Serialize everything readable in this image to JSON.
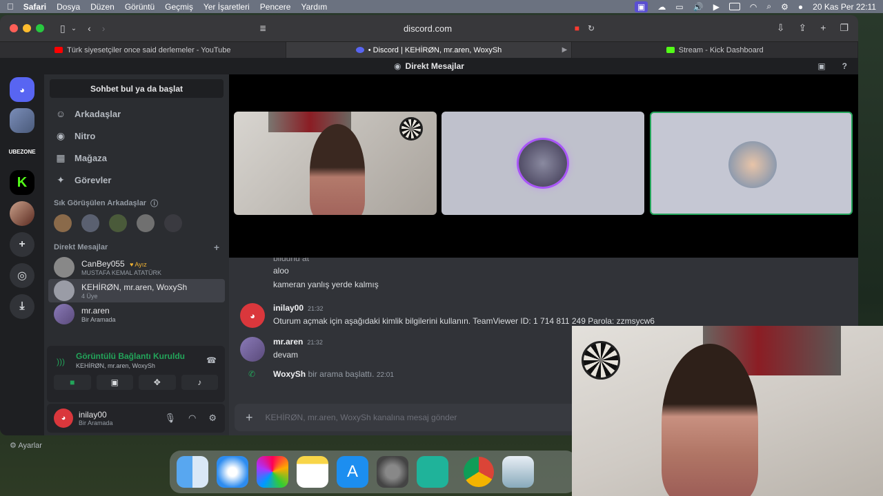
{
  "menubar": {
    "app": "Safari",
    "items": [
      "Dosya",
      "Düzen",
      "Görüntü",
      "Geçmiş",
      "Yer İşaretleri",
      "Pencere",
      "Yardım"
    ],
    "clock": "20 Kas Per  22:11"
  },
  "browser": {
    "url": "discord.com",
    "tabs": [
      {
        "title": "Türk siyesetçiler once said derlemeler - YouTube",
        "favicon_color": "#ff0000"
      },
      {
        "title": "• Discord | KEHİRØN, mr.aren, WoxySh",
        "favicon_color": "#5865f2"
      },
      {
        "title": "Stream - Kick Dashboard",
        "favicon_color": "#53fc18"
      }
    ]
  },
  "discord": {
    "title": "Direkt Mesajlar",
    "guild_label_tubezone": "UBEZONE",
    "search_label": "Sohbet bul ya da başlat",
    "nav": [
      {
        "label": "Arkadaşlar",
        "icon": "person-wave-icon"
      },
      {
        "label": "Nitro",
        "icon": "nitro-icon"
      },
      {
        "label": "Mağaza",
        "icon": "shop-icon"
      },
      {
        "label": "Görevler",
        "icon": "quests-icon"
      }
    ],
    "frequent_label": "Sık Görüşülen Arkadaşlar",
    "dm_label": "Direkt Mesajlar",
    "dms": [
      {
        "name": "CanBey055",
        "badge": "Ayız",
        "sub": "MUSTAFA KEMAL ATATÜRK"
      },
      {
        "name": "KEHİRØN, mr.aren, WoxySh",
        "sub": "4 Üye"
      },
      {
        "name": "mr.aren",
        "sub": "Bir Aramada"
      }
    ],
    "voice": {
      "status": "Görüntülü Bağlantı Kuruldu",
      "channel": "KEHİRØN, mr.aren, WoxySh"
    },
    "user": {
      "name": "inilay00",
      "status": "Bir Aramada"
    },
    "settings_label": "Ayarlar",
    "messages": {
      "partial": "bildunu at",
      "lines": [
        "aloo",
        "kameran yanlış yerde kalmış"
      ],
      "posts": [
        {
          "author": "inilay00",
          "time": "21:32",
          "text": "Oturum açmak için aşağıdaki kimlik bilgilerini kullanın. TeamViewer ID: 1 714 811 249 Parola: zzmsycw6"
        },
        {
          "author": "mr.aren",
          "time": "21:32",
          "text": "devam"
        }
      ],
      "system": {
        "author": "WoxySh",
        "text": "bir arama başlattı.",
        "time": "22:01"
      }
    },
    "composer_placeholder": "KEHİRØN, mr.aren, WoxySh kanalına mesaj gönder"
  },
  "colors": {
    "accent": "#5865f2",
    "online": "#23a55a",
    "danger": "#da373c"
  }
}
